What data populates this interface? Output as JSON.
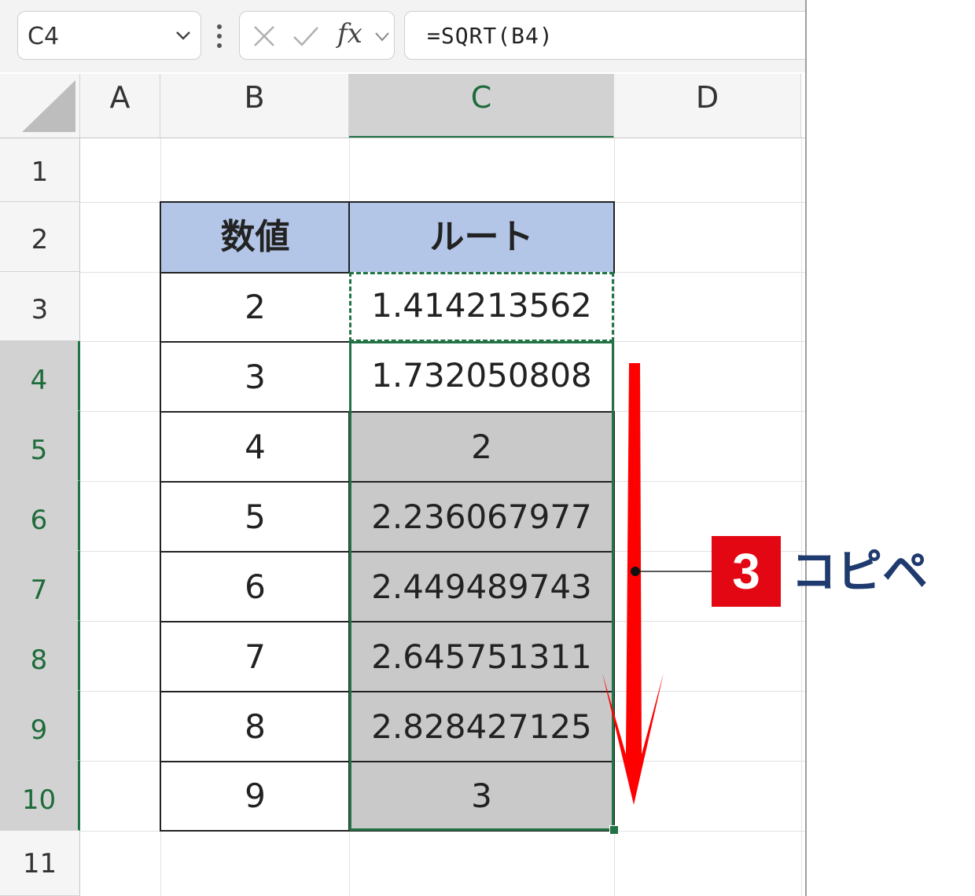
{
  "formula_bar": {
    "name_box": "C4",
    "formula": "=SQRT(B4)",
    "fx_label": "fx",
    "icons": [
      "chevron-down-icon",
      "more-vertical-icon",
      "cancel-x-icon",
      "confirm-check-icon",
      "function-fx-icon"
    ]
  },
  "columns": [
    "A",
    "B",
    "C",
    "D"
  ],
  "selected_column": "C",
  "rows": [
    "1",
    "2",
    "3",
    "4",
    "5",
    "6",
    "7",
    "8",
    "9",
    "10",
    "11"
  ],
  "selected_rows": [
    "4",
    "5",
    "6",
    "7",
    "8",
    "9",
    "10"
  ],
  "table": {
    "headers": [
      "数値",
      "ルート"
    ],
    "rows": [
      [
        "2",
        "1.414213562"
      ],
      [
        "3",
        "1.732050808"
      ],
      [
        "4",
        "2"
      ],
      [
        "5",
        "2.236067977"
      ],
      [
        "6",
        "2.449489743"
      ],
      [
        "7",
        "2.645751311"
      ],
      [
        "8",
        "2.828427125"
      ],
      [
        "9",
        "3"
      ]
    ]
  },
  "annotation": {
    "step_number": "3",
    "label": "コピペ"
  },
  "colors": {
    "header_fill": "#b4c6e7",
    "selection_fill": "#c9c9c9",
    "selection_border": "#217346",
    "badge": "#e30613",
    "arrow": "#ff0000",
    "label_text": "#1f3a6e"
  }
}
